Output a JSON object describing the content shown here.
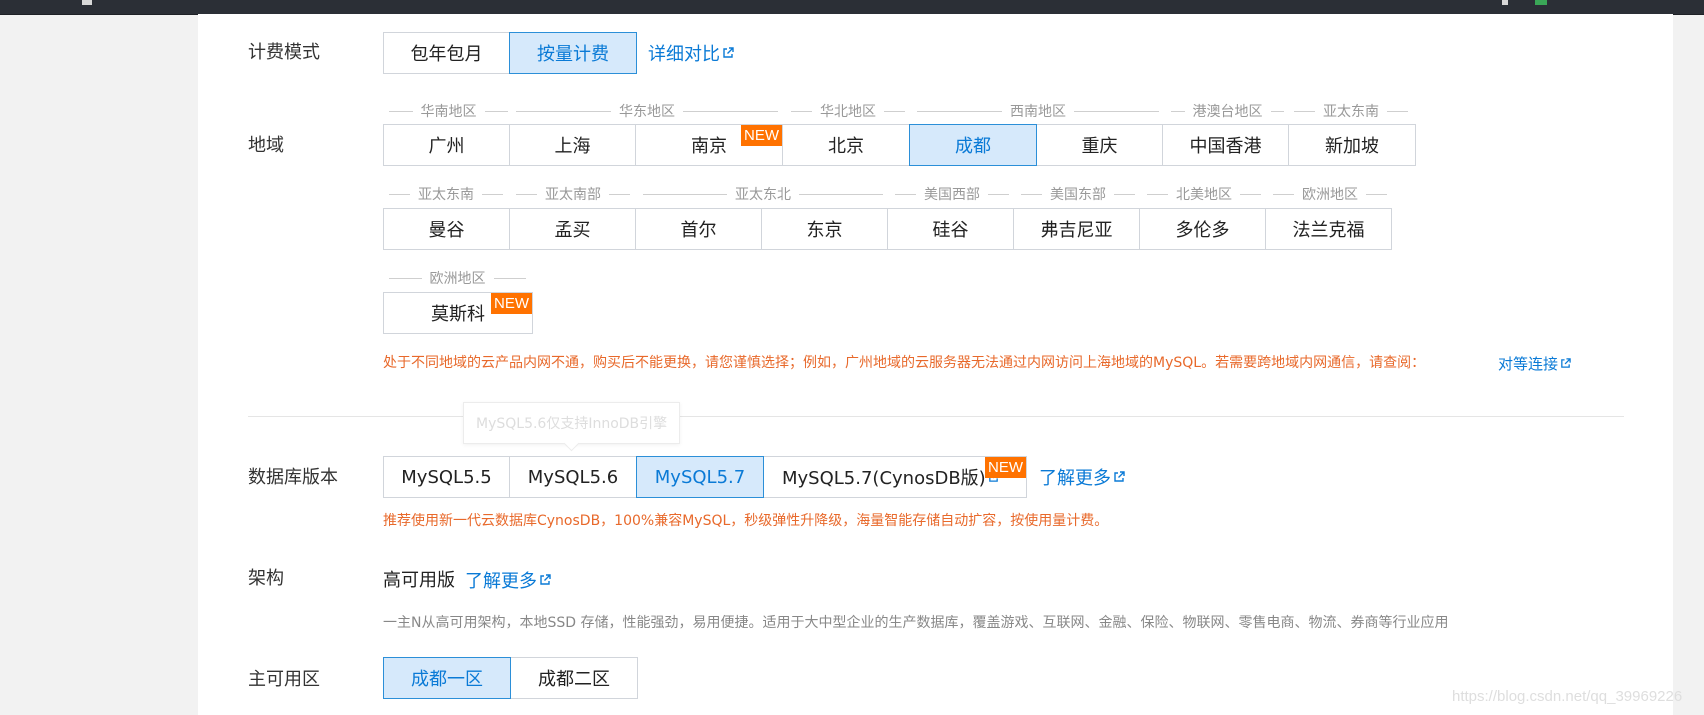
{
  "billing": {
    "label": "计费模式",
    "options": [
      "包年包月",
      "按量计费"
    ],
    "selected": "按量计费",
    "compare_link": "详细对比"
  },
  "region": {
    "label": "地域",
    "row1_groups": [
      "华南地区",
      "华东地区",
      "华北地区",
      "西南地区",
      "港澳台地区",
      "亚太东南"
    ],
    "row1": [
      "广州",
      "上海",
      "南京",
      "北京",
      "成都",
      "重庆",
      "中国香港",
      "新加坡"
    ],
    "row2_groups": [
      "亚太东南",
      "亚太南部",
      "亚太东北",
      "美国西部",
      "美国东部",
      "北美地区",
      "欧洲地区"
    ],
    "row2": [
      "曼谷",
      "孟买",
      "首尔",
      "东京",
      "硅谷",
      "弗吉尼亚",
      "多伦多",
      "法兰克福"
    ],
    "row3_group": "欧洲地区",
    "row3": [
      "莫斯科"
    ],
    "selected": "成都",
    "new_badge": "NEW",
    "warning": "处于不同地域的云产品内网不通，购买后不能更换，请您谨慎选择；例如，广州地域的云服务器无法通过内网访问上海地域的MySQL。若需要跨地域内网通信，请查阅：",
    "peer_link": "对等连接"
  },
  "tooltip": "MySQL5.6仅支持InnoDB引擎",
  "db_version": {
    "label": "数据库版本",
    "options": [
      "MySQL5.5",
      "MySQL5.6",
      "MySQL5.7",
      "MySQL5.7(CynosDB版)"
    ],
    "selected": "MySQL5.7",
    "new_badge": "NEW",
    "learn_more": "了解更多",
    "note": "推荐使用新一代云数据库CynosDB，100%兼容MySQL，秒级弹性升降级，海量智能存储自动扩容，按使用量计费。"
  },
  "arch": {
    "label": "架构",
    "value": "高可用版",
    "learn_more": "了解更多",
    "desc": "一主N从高可用架构，本地SSD 存储，性能强劲，易用便捷。适用于大中型企业的生产数据库，覆盖游戏、互联网、金融、保险、物联网、零售电商、物流、券商等行业应用"
  },
  "zone": {
    "label": "主可用区",
    "options": [
      "成都一区",
      "成都二区"
    ],
    "selected": "成都一区"
  },
  "watermark": "https://blog.csdn.net/qq_39969226",
  "colors": {
    "accent": "#0a7ad6",
    "selected_bg": "#d6e9fb",
    "new_badge": "#ff7200",
    "warning": "#e8692b"
  }
}
